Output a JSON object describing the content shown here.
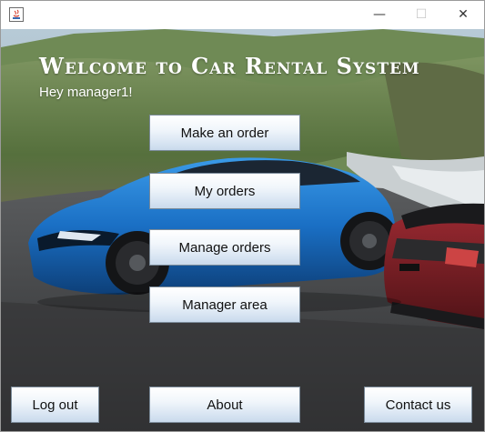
{
  "window": {
    "title": "",
    "controls": {
      "minimize": "—",
      "maximize": "☐",
      "close": "✕"
    }
  },
  "header": {
    "welcome": "Welcome to Car Rental System",
    "greeting": "Hey manager1!"
  },
  "menu": {
    "make_order": "Make an order",
    "my_orders": "My orders",
    "manage_orders": "Manage orders",
    "manager_area": "Manager area"
  },
  "footer": {
    "logout": "Log out",
    "about": "About",
    "contact": "Contact us"
  },
  "background": {
    "subject": "blue sports car and red convertible on coastal road",
    "colors": {
      "sky": "#9fb8c9",
      "hills": "#5f7a45",
      "road": "#3c3d3f",
      "blue_car": "#1a6fc4",
      "red_car": "#7a1e25"
    }
  }
}
